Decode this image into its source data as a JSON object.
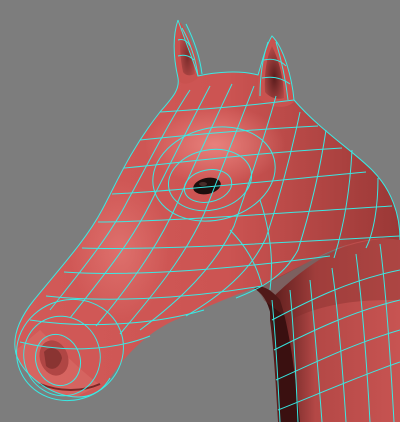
{
  "viewport": {
    "background_color": "#7d7d7d",
    "model": {
      "subject": "horse-head",
      "shading_mode": "smooth-shaded-with-wireframe",
      "surface_color": "#d25a58",
      "surface_shadow_color": "#5a1c1c",
      "surface_highlight_color": "#ee8c86",
      "wireframe_color": "#36f0ea",
      "eye_color": "#1c0f0d"
    }
  }
}
